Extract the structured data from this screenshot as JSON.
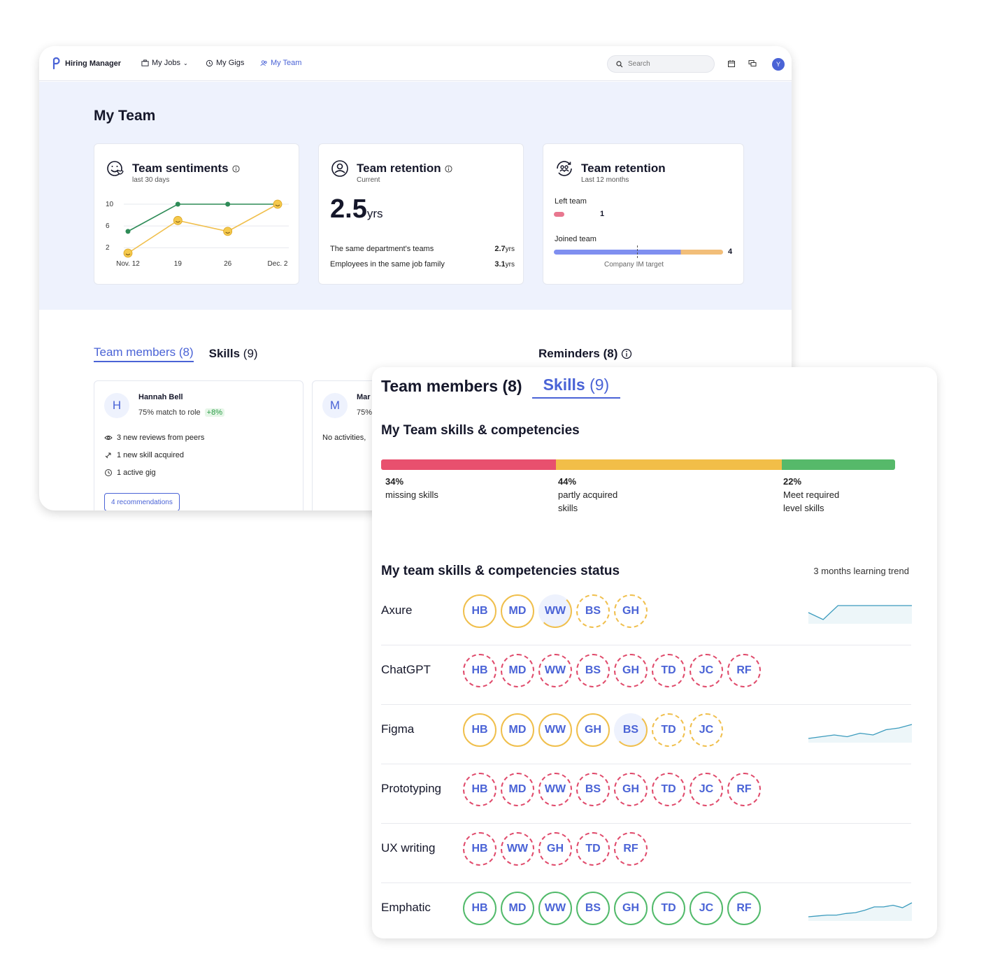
{
  "nav": {
    "brand": "Hiring Manager",
    "items": [
      {
        "label": "My Jobs"
      },
      {
        "label": "My Gigs"
      },
      {
        "label": "My Team"
      }
    ],
    "search_placeholder": "Search",
    "avatar": "Y"
  },
  "page": {
    "title": "My Team"
  },
  "cards": {
    "sentiments": {
      "title": "Team sentiments",
      "subtitle": "last 30 days",
      "chart_data": {
        "type": "line",
        "x": [
          "Nov. 12",
          "19",
          "26",
          "Dec. 2"
        ],
        "y_ticks": [
          "10",
          "6",
          "2"
        ],
        "ylim": [
          1,
          10
        ],
        "series": [
          {
            "values": [
              5,
              10,
              10,
              10
            ],
            "color": "#2e8b57"
          },
          {
            "values": [
              1,
              7,
              5,
              10
            ],
            "color": "#f0bf4c"
          }
        ]
      }
    },
    "retention_current": {
      "title": "Team retention",
      "subtitle": "Current",
      "value": "2.5",
      "unit": "yrs",
      "rows": [
        {
          "label": "The same department's teams",
          "value": "2.7",
          "unit": "yrs"
        },
        {
          "label": "Employees in the same job family",
          "value": "3.1",
          "unit": "yrs"
        }
      ]
    },
    "retention_12m": {
      "title": "Team retention",
      "subtitle": "Last 12 months",
      "left_label": "Left team",
      "left_value": "1",
      "joined_label": "Joined team",
      "joined_value": "4",
      "target_label": "Company IM target",
      "chart_data": {
        "type": "bar",
        "categories": [
          "Left team",
          "Joined team"
        ],
        "values": [
          1,
          4
        ]
      }
    }
  },
  "back_tabs": {
    "members": "Team members (8)",
    "skills_label": "Skills",
    "skills_count": "(9)",
    "reminders": "Reminders (8)"
  },
  "members": [
    {
      "initial": "H",
      "name": "Hannah Bell",
      "match": "75% match to role",
      "delta": "+8%",
      "activities": [
        "3 new reviews from peers",
        "1 new skill acquired",
        "1 active gig"
      ],
      "button": "4 recommendations"
    },
    {
      "initial": "M",
      "name": "Mar",
      "match": "75%",
      "activities": [
        "No activities,"
      ]
    }
  ],
  "front": {
    "tab_members_label": "Team members",
    "tab_members_count": "(8)",
    "tab_skills_label": "Skills",
    "tab_skills_count": "(9)",
    "competencies_title": "My Team skills & competencies",
    "breakdown": [
      {
        "pct": "34%",
        "label": "missing skills",
        "value": 34,
        "color": "#e8506e"
      },
      {
        "pct": "44%",
        "label": "partly acquired skills",
        "value": 44,
        "color": "#f2be48"
      },
      {
        "pct": "22%",
        "label": "Meet required level skills",
        "value": 22,
        "color": "#56b96a"
      }
    ],
    "status_title": "My team skills & competencies status",
    "trend_label": "3 months learning trend",
    "skills": [
      {
        "name": "Axure",
        "chips": [
          [
            "HB",
            "full-y"
          ],
          [
            "MD",
            "full-y"
          ],
          [
            "WW",
            "half-y"
          ],
          [
            "BS",
            "dash-y"
          ],
          [
            "GH",
            "dash-y"
          ]
        ],
        "trend": [
          3,
          2,
          4,
          4,
          4,
          4,
          4,
          4
        ]
      },
      {
        "name": "ChatGPT",
        "chips": [
          [
            "HB",
            "dash-r"
          ],
          [
            "MD",
            "dash-r"
          ],
          [
            "WW",
            "dash-r"
          ],
          [
            "BS",
            "dash-r"
          ],
          [
            "GH",
            "dash-r"
          ],
          [
            "TD",
            "dash-r"
          ],
          [
            "JC",
            "dash-r"
          ],
          [
            "RF",
            "dash-r"
          ]
        ],
        "trend": []
      },
      {
        "name": "Figma",
        "chips": [
          [
            "HB",
            "full-y"
          ],
          [
            "MD",
            "full-y"
          ],
          [
            "WW",
            "full-y"
          ],
          [
            "GH",
            "full-y"
          ],
          [
            "BS",
            "half-y"
          ],
          [
            "TD",
            "dash-y"
          ],
          [
            "JC",
            "dash-y"
          ]
        ],
        "trend": [
          1,
          2,
          3,
          2,
          4,
          3,
          6,
          7,
          9
        ]
      },
      {
        "name": "Prototyping",
        "chips": [
          [
            "HB",
            "dash-r"
          ],
          [
            "MD",
            "dash-r"
          ],
          [
            "WW",
            "dash-r"
          ],
          [
            "BS",
            "dash-r"
          ],
          [
            "GH",
            "dash-r"
          ],
          [
            "TD",
            "dash-r"
          ],
          [
            "JC",
            "dash-r"
          ],
          [
            "RF",
            "dash-r"
          ]
        ],
        "trend": []
      },
      {
        "name": "UX writing",
        "chips": [
          [
            "HB",
            "dash-r"
          ],
          [
            "WW",
            "dash-r"
          ],
          [
            "GH",
            "dash-r"
          ],
          [
            "TD",
            "dash-r"
          ],
          [
            "RF",
            "dash-r"
          ]
        ],
        "trend": []
      },
      {
        "name": "Emphatic",
        "chips": [
          [
            "HB",
            "full-g"
          ],
          [
            "MD",
            "full-g"
          ],
          [
            "WW",
            "full-g"
          ],
          [
            "BS",
            "full-g"
          ],
          [
            "GH",
            "full-g"
          ],
          [
            "TD",
            "full-g"
          ],
          [
            "JC",
            "full-g"
          ],
          [
            "RF",
            "full-g"
          ]
        ],
        "trend": [
          1,
          2,
          3,
          3,
          5,
          6,
          9,
          13,
          13,
          15,
          12,
          18
        ]
      }
    ]
  }
}
